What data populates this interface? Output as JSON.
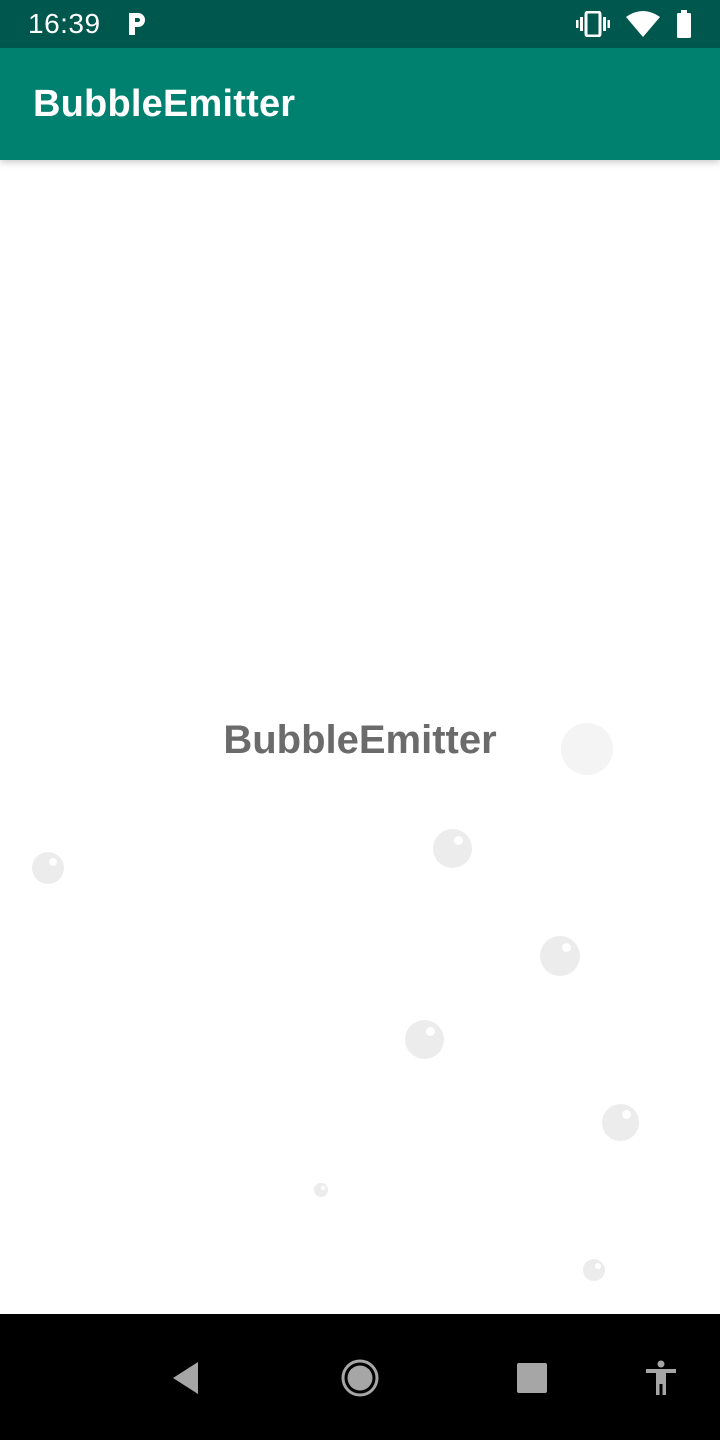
{
  "status_bar": {
    "time": "16:39",
    "icons": [
      "parking-app-icon",
      "vibrate-icon",
      "wifi-icon",
      "battery-icon"
    ]
  },
  "app_bar": {
    "title": "BubbleEmitter"
  },
  "content": {
    "label": "BubbleEmitter"
  },
  "nav_bar": {
    "icons": [
      "back-icon",
      "home-icon",
      "recents-icon",
      "accessibility-icon"
    ]
  },
  "colors": {
    "status_bar": "#00574d",
    "app_bar": "#00806f",
    "label_text": "#6b6b6b",
    "bubble": "#ececec",
    "nav_bar": "#000000"
  }
}
